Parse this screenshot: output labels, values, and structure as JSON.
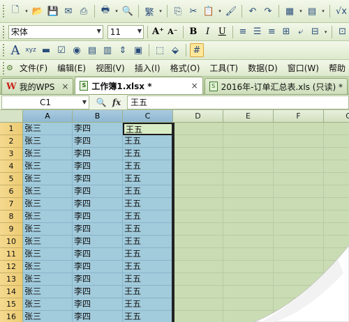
{
  "toolbar": {
    "font_name": "宋体",
    "font_size": "11"
  },
  "menu": {
    "items": [
      "文件(F)",
      "编辑(E)",
      "视图(V)",
      "插入(I)",
      "格式(O)",
      "工具(T)",
      "数据(D)",
      "窗口(W)",
      "帮助"
    ]
  },
  "tabs": {
    "wps_logo": "W",
    "home": "我的WPS",
    "active": "工作簿1.xlsx *",
    "other": "2016年-订单汇总表.xls (只读) *",
    "close_glyph": "×"
  },
  "formula": {
    "name_box": "C1",
    "value": "王五"
  },
  "columns": [
    "A",
    "B",
    "C",
    "D",
    "E",
    "F",
    "G"
  ],
  "rows": [
    [
      "张三",
      "李四",
      "王五"
    ],
    [
      "张三",
      "李四",
      "王五"
    ],
    [
      "张三",
      "李四",
      "王五"
    ],
    [
      "张三",
      "李四",
      "王五"
    ],
    [
      "张三",
      "李四",
      "王五"
    ],
    [
      "张三",
      "李四",
      "王五"
    ],
    [
      "张三",
      "李四",
      "王五"
    ],
    [
      "张三",
      "李四",
      "王五"
    ],
    [
      "张三",
      "李四",
      "王五"
    ],
    [
      "张三",
      "李四",
      "王五"
    ],
    [
      "张三",
      "李四",
      "王五"
    ],
    [
      "张三",
      "李四",
      "王五"
    ],
    [
      "张三",
      "李四",
      "王五"
    ],
    [
      "张三",
      "李四",
      "王五"
    ],
    [
      "张三",
      "李四",
      "王五"
    ],
    [
      "张三",
      "李四",
      "王五"
    ]
  ],
  "row_numbers": [
    "1",
    "2",
    "3",
    "4",
    "5",
    "6",
    "7",
    "8",
    "9",
    "10",
    "11",
    "12",
    "13",
    "14",
    "15",
    "16"
  ]
}
